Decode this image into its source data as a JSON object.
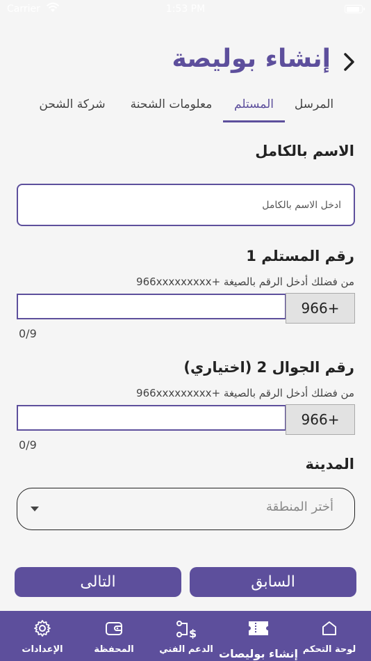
{
  "status_bar": {
    "carrier": "Carrier",
    "time": "1:53 PM",
    "battery_level": 0.9
  },
  "header": {
    "title": "إنشاء بوليصة"
  },
  "tabs": [
    {
      "label": "المرسل",
      "active": false
    },
    {
      "label": "المستلم",
      "active": true
    },
    {
      "label": "معلومات الشحنة",
      "active": false
    },
    {
      "label": "شركة الشحن",
      "active": false
    }
  ],
  "form": {
    "full_name": {
      "label": "الاسم بالكامل",
      "placeholder": "ادخل الاسم بالكامل",
      "value": ""
    },
    "phone1": {
      "label": "رقم المستلم 1",
      "hint": "من فضلك أدخل الرقم بالصيغة +966xxxxxxxxx",
      "prefix": "966+",
      "value": "",
      "counter": "0/9"
    },
    "phone2": {
      "label": "رقم الجوال 2 (اختياري)",
      "hint": "من فضلك أدخل الرقم بالصيغة +966xxxxxxxxx",
      "prefix": "966+",
      "value": "",
      "counter": "0/9"
    },
    "city": {
      "label": "المدينة",
      "placeholder": "أختر المنطقة"
    }
  },
  "buttons": {
    "previous": "السابق",
    "next": "التالى"
  },
  "tabbar": [
    {
      "label": "لوحة التحكم",
      "icon": "home-icon"
    },
    {
      "label": "إنشاء بوليصات",
      "icon": "ticket-icon",
      "active": true
    },
    {
      "label": "الدعم الفني",
      "icon": "support-icon"
    },
    {
      "label": "المحفظة",
      "icon": "wallet-icon"
    },
    {
      "label": "الإعدادات",
      "icon": "gear-icon"
    }
  ],
  "colors": {
    "brand": "#5d4f9c",
    "background": "#f5f5f5"
  }
}
